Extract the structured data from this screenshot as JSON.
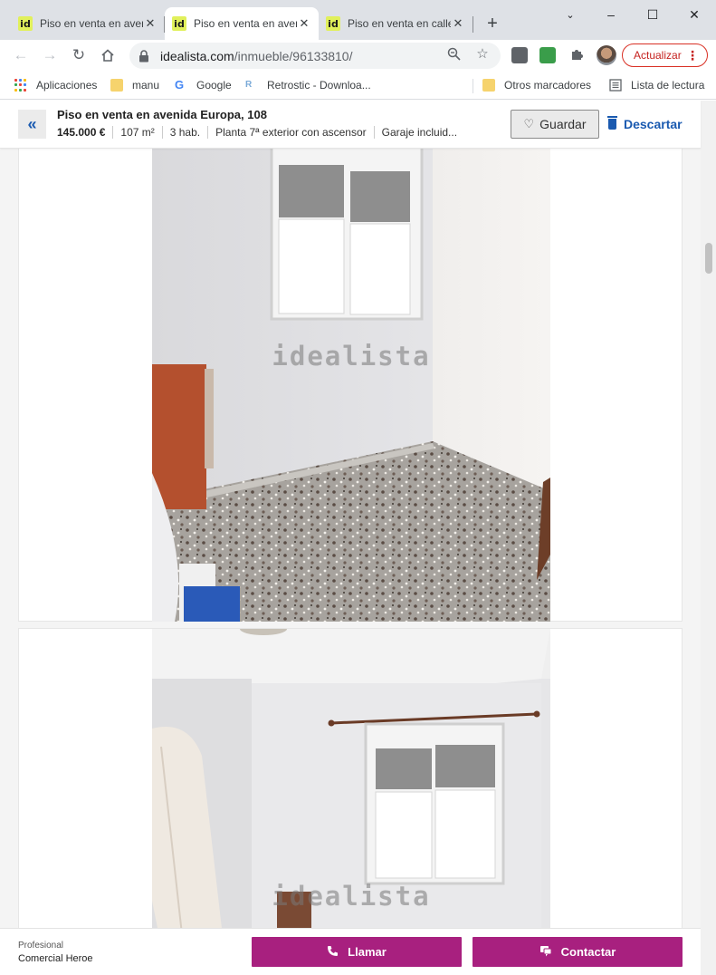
{
  "browser": {
    "tabs": [
      {
        "favicon": "id",
        "title": "Piso en venta en avenida Europa",
        "active": false
      },
      {
        "favicon": "id",
        "title": "Piso en venta en avenida Europa",
        "active": true
      },
      {
        "favicon": "id",
        "title": "Piso en venta en calle",
        "active": false
      }
    ],
    "new_tab_symbol": "+",
    "window_controls": {
      "minimize": "–",
      "maximize": "☐",
      "close": "✕"
    },
    "url_host": "idealista.com",
    "url_path": "/inmueble/96133810/",
    "update_label": "Actualizar",
    "bookmarks": [
      {
        "icon": "apps-grid-icon",
        "label": "Aplicaciones"
      },
      {
        "icon": "folder-icon",
        "label": "manu"
      },
      {
        "icon": "google-icon",
        "label": "Google"
      },
      {
        "icon": "retrostic-icon",
        "label": "Retrostic - Downloa..."
      }
    ],
    "other_bookmarks": "Otros marcadores",
    "reading_list": "Lista de lectura"
  },
  "listing": {
    "title": "Piso en venta en avenida Europa, 108",
    "price": "145.000 €",
    "area": "107 m²",
    "rooms": "3 hab.",
    "floor": "Planta 7ª exterior con ascensor",
    "extra": "Garaje incluid..."
  },
  "actions": {
    "back_icon": "«",
    "save_label": "Guardar",
    "discard_label": "Descartar"
  },
  "photos": [
    {
      "watermark": "idealista"
    },
    {
      "watermark": "idealista"
    }
  ],
  "agent": {
    "type": "Profesional",
    "name": "Comercial Heroe"
  },
  "cta": {
    "call_label": "Llamar",
    "contact_label": "Contactar"
  },
  "colors": {
    "accent_blue": "#1a5ab0",
    "cta_magenta": "#a8207f",
    "update_red": "#d93025",
    "favicon_yellow": "#e1f05b"
  }
}
